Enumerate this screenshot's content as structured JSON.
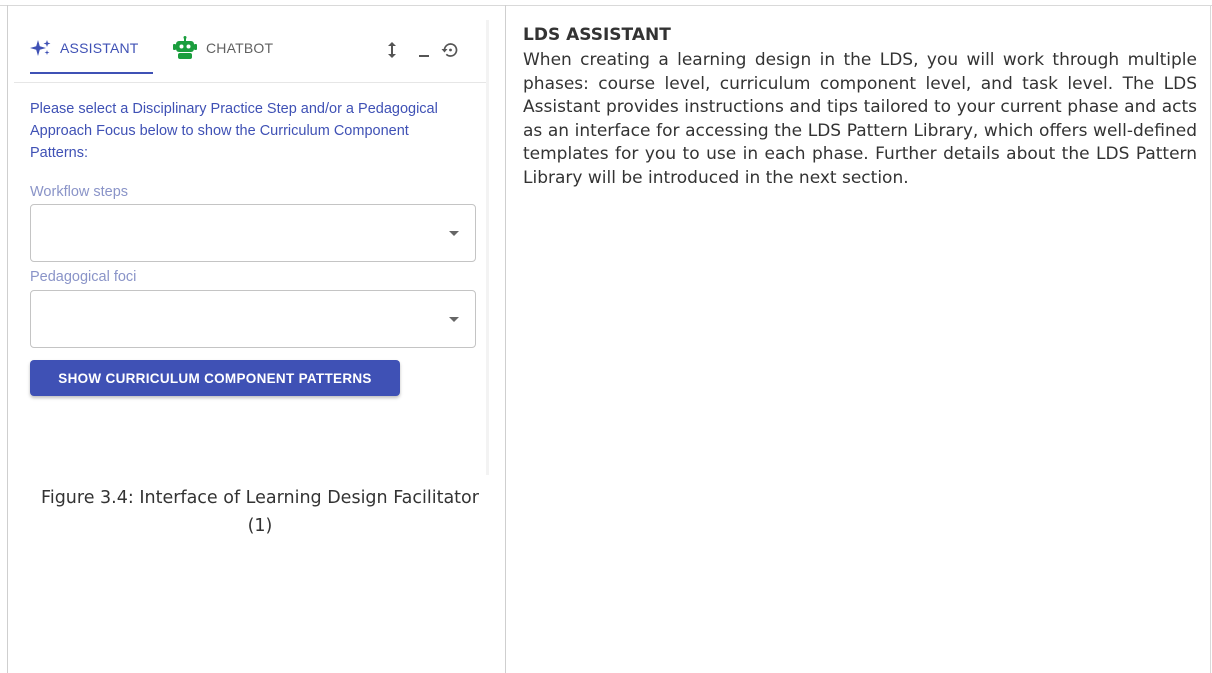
{
  "widget": {
    "tabs": [
      {
        "label": "ASSISTANT",
        "icon": "sparkle-icon",
        "active": true
      },
      {
        "label": "CHATBOT",
        "icon": "robot-icon",
        "active": false
      }
    ],
    "controls": [
      "resize-vertical-icon",
      "minimize-icon",
      "reset-icon"
    ],
    "intro": "Please select a Disciplinary Practice Step and/or a Pedagogical Approach Focus below to show the Curriculum Component Patterns:",
    "workflow_label": "Workflow steps",
    "workflow_value": "",
    "foci_label": "Pedagogical foci",
    "foci_value": "",
    "button_label": "SHOW CURRICULUM COMPONENT PATTERNS",
    "accent_color": "#3f51b5"
  },
  "caption": "Figure 3.4: Interface of Learning Design Facilitator (1)",
  "section": {
    "title": "LDS ASSISTANT",
    "body": "When creating a learning design in the LDS, you will work through multiple phases: course level, curriculum component level, and task level. The LDS Assistant provides instructions and tips tailored to your current phase and acts as an interface for accessing the LDS Pattern Library, which offers well-defined templates for you to use in each phase. Further details about the LDS Pattern Library will be introduced in the next section."
  }
}
